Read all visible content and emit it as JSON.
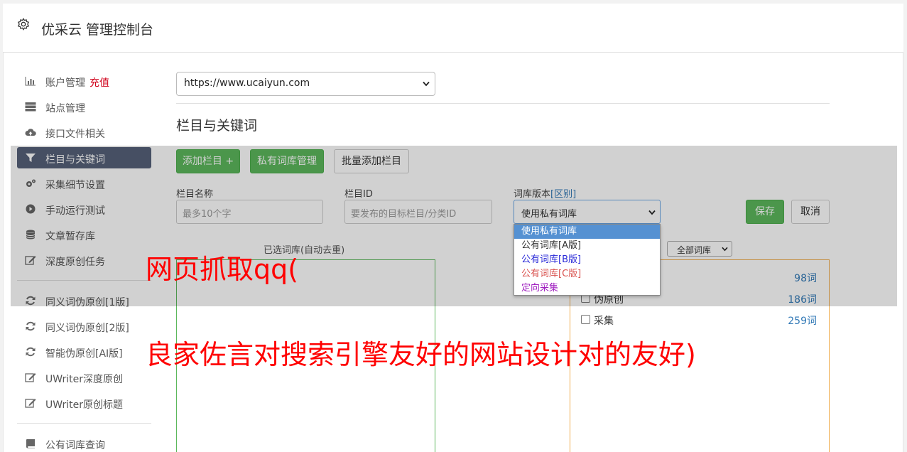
{
  "header": {
    "title": "优采云 管理控制台",
    "icon": "gear-icon"
  },
  "sidebar": {
    "items": [
      {
        "label": "账户管理",
        "extra": "充值",
        "icon": "bar-chart-icon"
      },
      {
        "label": "站点管理",
        "icon": "server-icon"
      },
      {
        "label": "接口文件相关",
        "icon": "cloud-upload-icon"
      },
      {
        "label": "栏目与关键词",
        "icon": "filter-icon",
        "active": true
      },
      {
        "label": "采集细节设置",
        "icon": "cogs-icon"
      },
      {
        "label": "手动运行测试",
        "icon": "play-circle-icon"
      },
      {
        "label": "文章暂存库",
        "icon": "database-icon"
      },
      {
        "label": "深度原创任务",
        "icon": "edit-icon"
      },
      {
        "label": "同义词伪原创[1版]",
        "icon": "refresh-icon"
      },
      {
        "label": "同义词伪原创[2版]",
        "icon": "refresh-icon"
      },
      {
        "label": "智能伪原创[AI版]",
        "icon": "refresh-icon"
      },
      {
        "label": "UWriter深度原创",
        "icon": "edit-icon"
      },
      {
        "label": "UWriter原创标题",
        "icon": "edit-icon"
      },
      {
        "label": "公有词库查询",
        "icon": "book-icon"
      }
    ]
  },
  "main": {
    "site_select": "https://www.ucaiyun.com",
    "section_title": "栏目与关键词",
    "buttons": {
      "add_column": "添加栏目 +",
      "private_lib": "私有词库管理",
      "batch_add": "批量添加栏目",
      "save": "保存",
      "cancel": "取消"
    },
    "form": {
      "name_label": "栏目名称",
      "name_placeholder": "最多10个字",
      "id_label": "栏目ID",
      "id_placeholder": "要发布的目标栏目/分类ID",
      "version_label": "词库版本",
      "version_link": "[区别]",
      "version_value": "使用私有词库"
    },
    "version_options": [
      "使用私有词库",
      "公有词库[A版]",
      "公有词库[B版]",
      "公有词库[C版]",
      "定向采集"
    ],
    "version_colors": [
      "#ffffff",
      "#333333",
      "#2a2ad8",
      "#d9534f",
      "#a020c0"
    ],
    "selected_caption": "已选词库(自动去重)",
    "lib_filter": "全部词库",
    "libs": [
      {
        "name": "",
        "count": "98词"
      },
      {
        "name": "伪原创",
        "count": "186词"
      },
      {
        "name": "采集",
        "count": "259词"
      }
    ]
  },
  "watermark": {
    "line1": "网页抓取qq(",
    "line2": "良家佐言对搜索引擎友好的网站设计对的友好)"
  }
}
